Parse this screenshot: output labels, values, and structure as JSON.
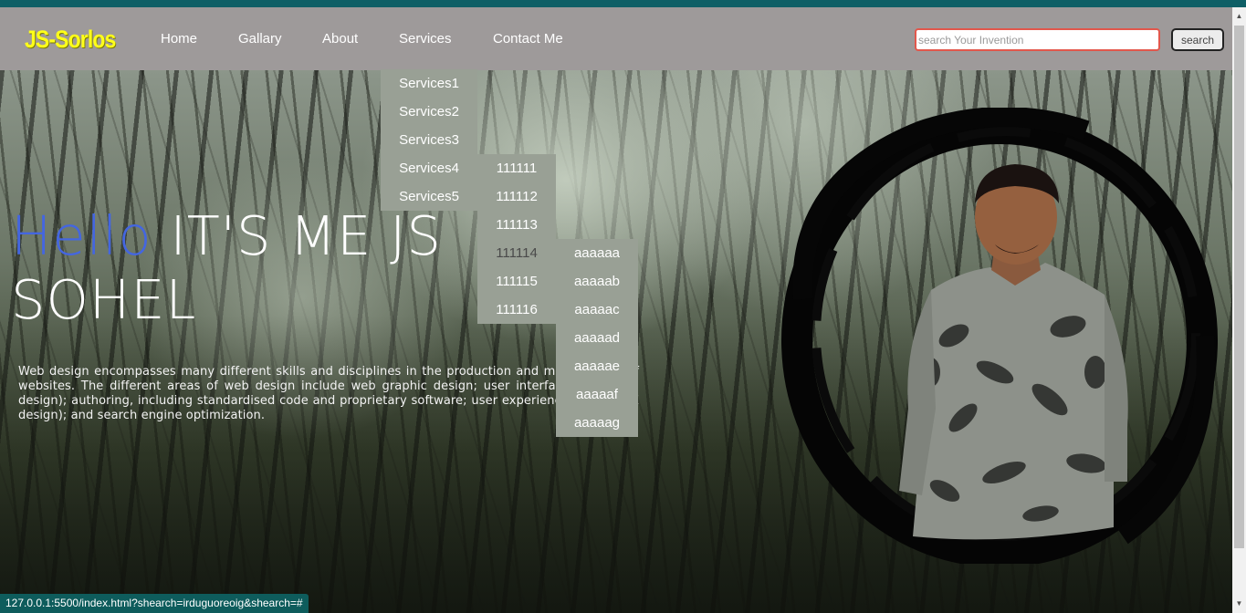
{
  "navbar": {
    "logo": "JS-Sorlos",
    "items": [
      {
        "label": "Home"
      },
      {
        "label": "Gallary"
      },
      {
        "label": "About"
      },
      {
        "label": "Services"
      },
      {
        "label": "Contact Me"
      }
    ],
    "search": {
      "placeholder": "search Your Invention",
      "button_label": "search"
    }
  },
  "services_menu": [
    "Services1",
    "Services2",
    "Services3",
    "Services4",
    "Services5"
  ],
  "services4_submenu": [
    "111111",
    "111112",
    "111113",
    "111114",
    "111115",
    "111116"
  ],
  "item_111114_submenu": [
    "aaaaaa",
    "aaaaab",
    "aaaaac",
    "aaaaad",
    "aaaaae",
    "aaaaaf",
    "aaaaag"
  ],
  "hero": {
    "hello": "Hello",
    "title_line1": "IT'S ME JS",
    "title_line2": "SOHEL",
    "description": "Web design encompasses many different skills and disciplines in the production and maintenance of websites. The different areas of web design include web graphic design; user interface design (UI design); authoring, including standardised code and proprietary software; user experience design (UX design); and search engine optimization."
  },
  "status_bar": {
    "url": "127.0.0.1:5500/index.html?shearch=irduguoreoig&shearch=#"
  },
  "colors": {
    "navbar_bg": "#9e9a9a",
    "logo": "#ffff1a",
    "hello_accent": "#4466e0",
    "dropdown_bg": "#99a095",
    "top_strip": "#0e5f66"
  },
  "icons": {
    "scroll_up": "triangle-up-icon",
    "scroll_down": "triangle-down-icon"
  }
}
